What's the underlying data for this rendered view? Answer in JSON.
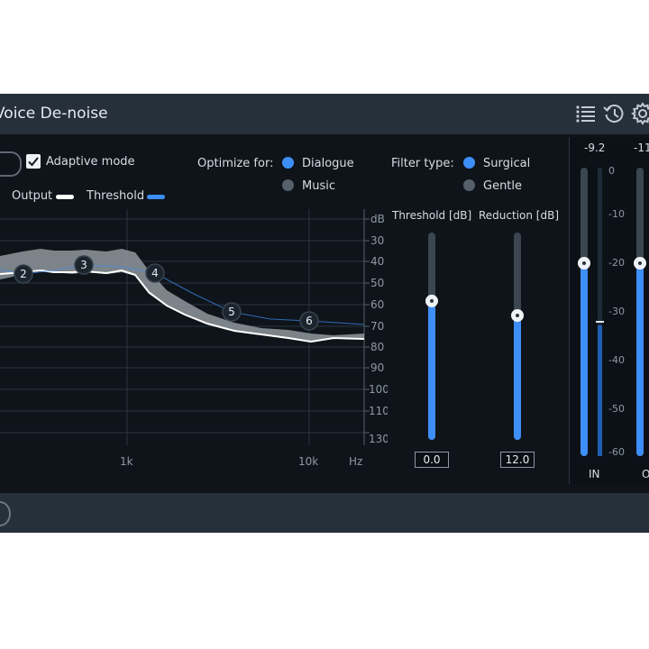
{
  "header": {
    "title": "Voice De-noise",
    "icons": [
      "list-icon",
      "history-icon",
      "settings-gear-icon"
    ]
  },
  "controls": {
    "adaptive_mode_label": "Adaptive mode",
    "adaptive_mode_checked": true,
    "optimize_label": "Optimize for:",
    "optimize_options": [
      {
        "label": "Dialogue",
        "selected": true
      },
      {
        "label": "Music",
        "selected": false
      }
    ],
    "filter_label": "Filter type:",
    "filter_options": [
      {
        "label": "Surgical",
        "selected": true
      },
      {
        "label": "Gentle",
        "selected": false
      }
    ]
  },
  "legend": {
    "output_label": "Output",
    "output_color": "#ffffff",
    "threshold_label": "Threshold",
    "threshold_color": "#3e8ef7"
  },
  "graph": {
    "db_unit": "dB",
    "db_ticks": [
      "30",
      "40",
      "50",
      "60",
      "70",
      "80",
      "90",
      "100",
      "110",
      "130"
    ],
    "freq_ticks": [
      "1k",
      "10k"
    ],
    "freq_unit": "Hz",
    "nodes": [
      "2",
      "3",
      "4",
      "5",
      "6"
    ]
  },
  "sliders": {
    "threshold": {
      "label": "Threshold [dB]",
      "value": "0.0",
      "fill_fraction": 0.67
    },
    "reduction": {
      "label": "Reduction [dB]",
      "value": "12.0",
      "fill_fraction": 0.6
    }
  },
  "meters": {
    "in_peak": "-9.2",
    "out_peak": "-11.",
    "scale": [
      "0",
      "-10",
      "-20",
      "-30",
      "-40",
      "-50",
      "-60"
    ],
    "in_label": "IN",
    "out_label": "O"
  },
  "colors": {
    "accent": "#3e8ef7",
    "panel_bg": "#0e141a",
    "title_bar_bg": "#26303a"
  }
}
